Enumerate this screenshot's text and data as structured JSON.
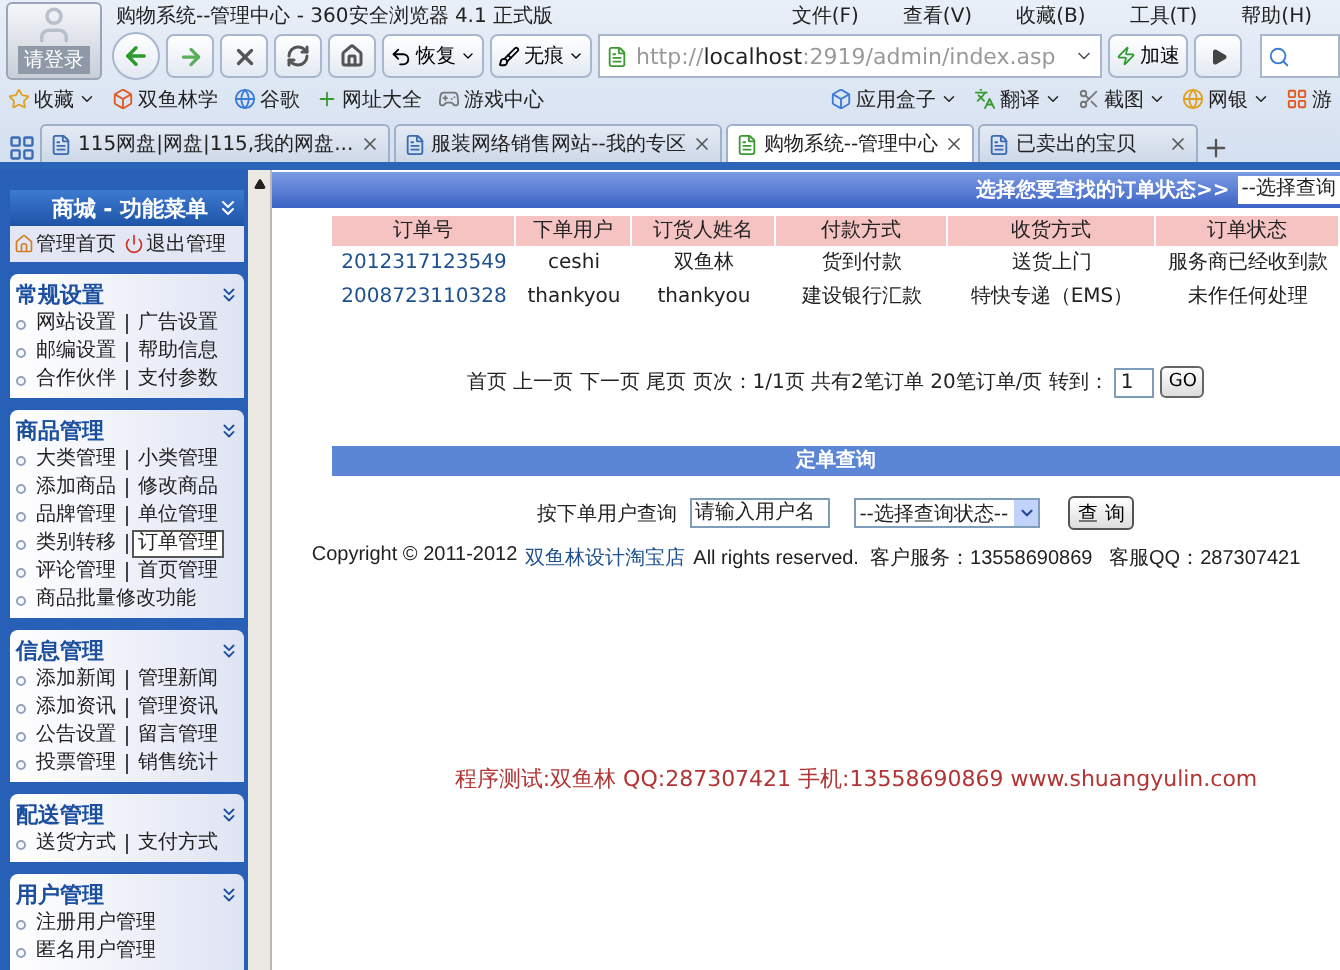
{
  "window": {
    "title": "购物系统--管理中心 - 360安全浏览器 4.1 正式版",
    "avatar_label": "请登录",
    "menu": [
      "文件(F)",
      "查看(V)",
      "收藏(B)",
      "工具(T)",
      "帮助(H)"
    ]
  },
  "toolbar": {
    "restore": "恢复",
    "incognito": "无痕",
    "address": {
      "prefix": "http://",
      "host": "localhost",
      "suffix": ":2919/admin/index.asp"
    },
    "speedup": "加速"
  },
  "bookmarks": {
    "left": [
      {
        "label": "收藏",
        "menu": true
      },
      {
        "label": "双鱼林学",
        "menu": false
      },
      {
        "label": "谷歌",
        "menu": false
      },
      {
        "label": "网址大全",
        "menu": false
      },
      {
        "label": "游戏中心",
        "menu": false
      }
    ],
    "right": [
      {
        "label": "应用盒子",
        "menu": true
      },
      {
        "label": "翻译",
        "menu": true
      },
      {
        "label": "截图",
        "menu": true
      },
      {
        "label": "网银",
        "menu": true
      },
      {
        "label": "游",
        "menu": false
      }
    ]
  },
  "tabs": [
    {
      "label": "115网盘|网盘|115,我的网盘...",
      "selected": false
    },
    {
      "label": "服装网络销售网站--我的专区",
      "selected": false
    },
    {
      "label": "购物系统--管理中心",
      "selected": true
    },
    {
      "label": "已卖出的宝贝",
      "selected": false
    }
  ],
  "sidebar": {
    "title": "商城 - 功能菜单",
    "quick_links": [
      "管理首页",
      "退出管理"
    ],
    "sections": [
      {
        "title": "常规设置",
        "rows": [
          [
            {
              "label": "网站设置",
              "selected": false
            },
            {
              "label": "广告设置",
              "selected": false
            }
          ],
          [
            {
              "label": "邮编设置",
              "selected": false
            },
            {
              "label": "帮助信息",
              "selected": false
            }
          ],
          [
            {
              "label": "合作伙伴",
              "selected": false
            },
            {
              "label": "支付参数",
              "selected": false
            }
          ]
        ]
      },
      {
        "title": "商品管理",
        "rows": [
          [
            {
              "label": "大类管理",
              "selected": false
            },
            {
              "label": "小类管理",
              "selected": false
            }
          ],
          [
            {
              "label": "添加商品",
              "selected": false
            },
            {
              "label": "修改商品",
              "selected": false
            }
          ],
          [
            {
              "label": "品牌管理",
              "selected": false
            },
            {
              "label": "单位管理",
              "selected": false
            }
          ],
          [
            {
              "label": "类别转移",
              "selected": false
            },
            {
              "label": "订单管理",
              "selected": true
            }
          ],
          [
            {
              "label": "评论管理",
              "selected": false
            },
            {
              "label": "首页管理",
              "selected": false
            }
          ],
          [
            {
              "label": "商品批量修改功能",
              "selected": false
            }
          ]
        ]
      },
      {
        "title": "信息管理",
        "rows": [
          [
            {
              "label": "添加新闻",
              "selected": false
            },
            {
              "label": "管理新闻",
              "selected": false
            }
          ],
          [
            {
              "label": "添加资讯",
              "selected": false
            },
            {
              "label": "管理资讯",
              "selected": false
            }
          ],
          [
            {
              "label": "公告设置",
              "selected": false
            },
            {
              "label": "留言管理",
              "selected": false
            }
          ],
          [
            {
              "label": "投票管理",
              "selected": false
            },
            {
              "label": "销售统计",
              "selected": false
            }
          ]
        ]
      },
      {
        "title": "配送管理",
        "rows": [
          [
            {
              "label": "送货方式",
              "selected": false
            },
            {
              "label": "支付方式",
              "selected": false
            }
          ]
        ]
      },
      {
        "title": "用户管理",
        "rows": [
          [
            {
              "label": "注册用户管理",
              "selected": false
            }
          ],
          [
            {
              "label": "匿名用户管理",
              "selected": false
            }
          ]
        ]
      }
    ]
  },
  "status_filter": {
    "label": "选择您要查找的订单状态>>",
    "select": "--选择查询"
  },
  "table": {
    "columns": [
      "订单号",
      "下单用户",
      "订货人姓名",
      "付款方式",
      "收货方式",
      "订单状态"
    ],
    "rows": [
      [
        "2012317123549",
        "ceshi",
        "双鱼林",
        "货到付款",
        "送货上门",
        "服务商已经收到款"
      ],
      [
        "2008723110328",
        "thankyou",
        "thankyou",
        "建设银行汇款",
        "特快专递（EMS）",
        "未作任何处理"
      ]
    ]
  },
  "pagination": {
    "text": "首页 上一页 下一页 尾页 页次：1/1页 共有2笔订单 20笔订单/页 转到：",
    "page": "1",
    "go": "GO"
  },
  "query": {
    "title": "定单查询",
    "label": "按下单用户查询",
    "input": "请输入用户名",
    "select": "--选择查询状态--",
    "button": "查 询"
  },
  "copyright": {
    "before": "Copyright © 2011-2012",
    "link": "双鱼林设计淘宝店",
    "after": "All rights reserved.  客户服务：13558690869   客服QQ：287307421"
  },
  "footer": "程序测试:双鱼林 QQ:287307421 手机:13558690869 www.shuangyulin.com"
}
